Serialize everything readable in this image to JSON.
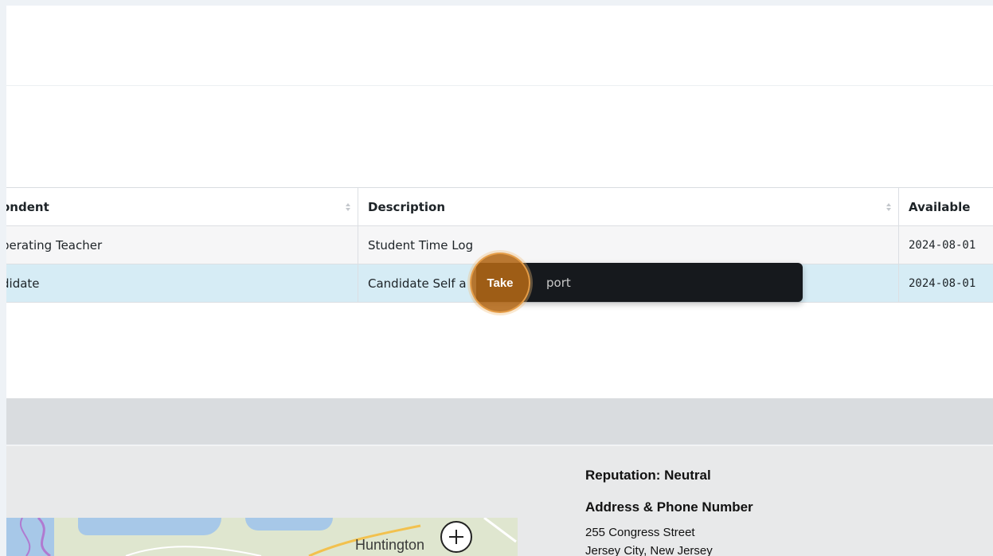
{
  "table": {
    "headers": {
      "respondent": "ondent",
      "description": "Description",
      "available": "Available"
    },
    "rows": [
      {
        "respondent": "perating Teacher",
        "description": "Student Time Log",
        "available": "2024-08-01"
      },
      {
        "respondent": "didate",
        "description": "Candidate Self a",
        "available": "2024-08-01"
      }
    ]
  },
  "tooltip": {
    "action_label": "Take",
    "text_fragment": "port"
  },
  "footer": {
    "reputation": "Reputation: Neutral",
    "address_title": "Address & Phone Number",
    "address_line_1": "255 Congress Street",
    "address_line_2": "Jersey City, New Jersey"
  },
  "map": {
    "place_label": "Huntington",
    "zoom_icon": "plus-icon"
  },
  "colors": {
    "selected_row": "#d6ecf5",
    "tooltip_bg": "#16191d",
    "take_button": "#b26616"
  }
}
